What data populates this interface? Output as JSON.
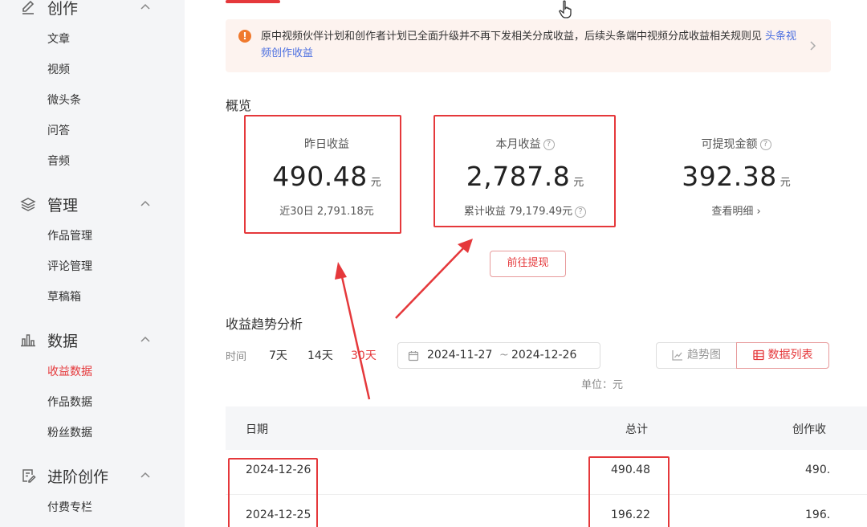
{
  "sidebar": {
    "sections": [
      {
        "title": "创作",
        "icon": "pen-icon",
        "items": [
          "文章",
          "视频",
          "微头条",
          "问答",
          "音频"
        ]
      },
      {
        "title": "管理",
        "icon": "layers-icon",
        "items": [
          "作品管理",
          "评论管理",
          "草稿箱"
        ]
      },
      {
        "title": "数据",
        "icon": "bar-chart-icon",
        "items": [
          "收益数据",
          "作品数据",
          "粉丝数据"
        ],
        "active_item": "收益数据"
      },
      {
        "title": "进阶创作",
        "icon": "edit-doc-icon",
        "items": [
          "付费专栏"
        ]
      }
    ]
  },
  "notice": {
    "text": "原中视频伙伴计划和创作者计划已全面升级并不再下发相关分成收益，后续头条端中视频分成收益相关规则见",
    "link": "头条视频创作收益",
    "icon_glyph": "!"
  },
  "overview": {
    "title": "概览",
    "cards": [
      {
        "label": "昨日收益",
        "value": "490.48",
        "unit": "元",
        "sub": "近30日 2,791.18元"
      },
      {
        "label": "本月收益",
        "value": "2,787.8",
        "unit": "元",
        "sub": "累计收益 79,179.49元"
      },
      {
        "label": "可提现金额",
        "value": "392.38",
        "unit": "元",
        "sub": "查看明细 ›"
      }
    ],
    "withdraw_button": "前往提现"
  },
  "trend": {
    "title": "收益趋势分析",
    "time_label": "时间",
    "ranges": [
      "7天",
      "14天",
      "30天"
    ],
    "active_range": "30天",
    "date_start": "2024-11-27",
    "date_sep": "~",
    "date_end": "2024-12-26",
    "view_trend": "趋势图",
    "view_list": "数据列表",
    "unit_note": "单位：元"
  },
  "table": {
    "columns": [
      "日期",
      "总计",
      "创作收"
    ],
    "rows": [
      [
        "2024-12-26",
        "490.48",
        "490."
      ],
      [
        "2024-12-25",
        "196.22",
        "196."
      ]
    ]
  },
  "colors": {
    "accent": "#e5383b",
    "notice_bg": "#fdf3ef",
    "sidebar_bg": "#f4f5f7"
  }
}
